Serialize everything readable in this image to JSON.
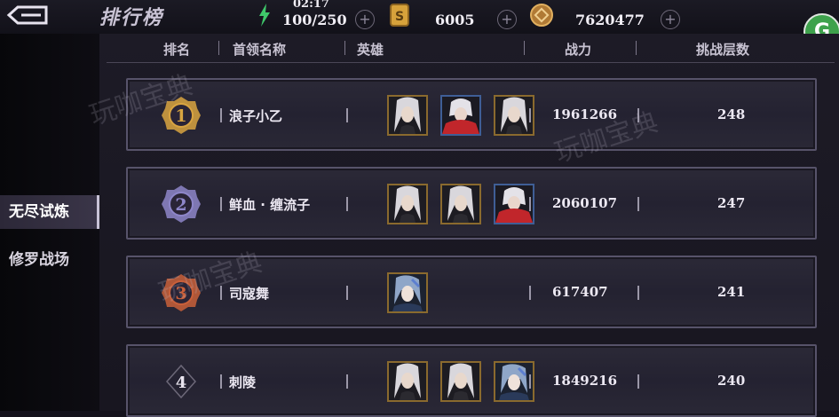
{
  "header_bar": {
    "title": "排行榜",
    "energy": {
      "timer": "02:17",
      "value": "100/250"
    },
    "coins": {
      "value": "6005"
    },
    "gold": {
      "value": "7620477"
    },
    "plus_symbol": "+",
    "badge_letter": "G"
  },
  "sidebar": {
    "tabs": [
      {
        "label": "无尽试炼",
        "active": true
      },
      {
        "label": "修罗战场",
        "active": false
      }
    ]
  },
  "table": {
    "columns": {
      "rank": "排名",
      "leader": "首领名称",
      "heroes": "英雄",
      "power": "战力",
      "floors": "挑战层数"
    },
    "rows": [
      {
        "rank": "1",
        "name": "浪子小乙",
        "power": "1961266",
        "floors": "248",
        "heroes": [
          "silver-hair-hero",
          "red-scarf-hero",
          "silver-hair-hero"
        ]
      },
      {
        "rank": "2",
        "name": "鲜血 · 缠流子",
        "power": "2060107",
        "floors": "247",
        "heroes": [
          "silver-hair-hero",
          "silver-hair-hero",
          "red-scarf-hero"
        ]
      },
      {
        "rank": "3",
        "name": "司寇舞",
        "power": "617407",
        "floors": "241",
        "heroes": [
          "blue-hair-hero"
        ]
      },
      {
        "rank": "4",
        "name": "刺陵",
        "power": "1849216",
        "floors": "240",
        "heroes": [
          "silver-hair-hero",
          "silver-hair-hero",
          "blue-hair-hero"
        ]
      }
    ]
  },
  "watermark": "玩咖宝典",
  "colors": {
    "gold_medal": "#d9a441",
    "silver_medal": "#8e86c9",
    "bronze_medal": "#c9603a",
    "hero_frame_gold": "#8a6a2e",
    "hero_frame_blue": "#3f5e96"
  }
}
